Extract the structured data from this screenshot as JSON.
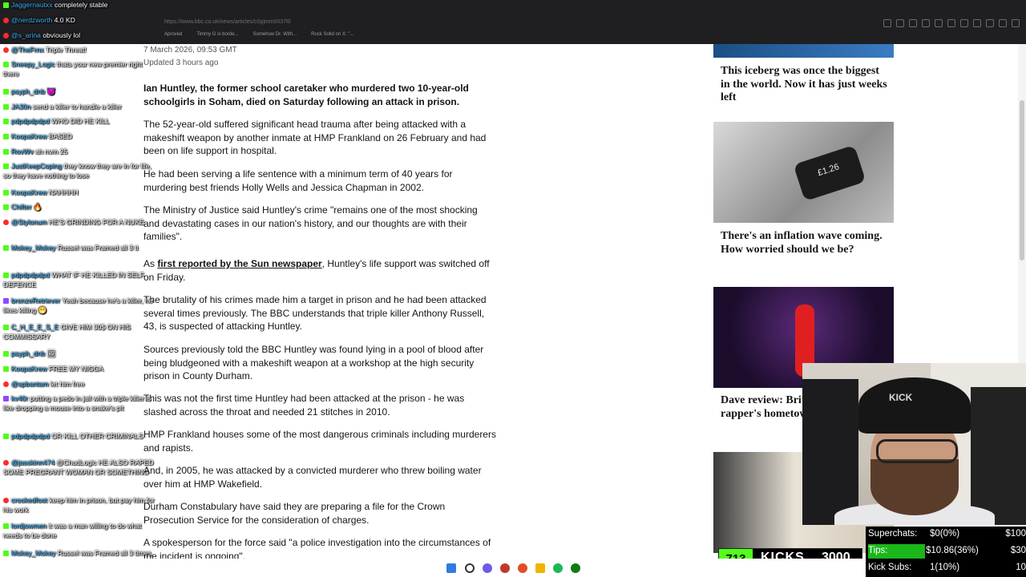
{
  "browser": {
    "url": "https://www.bbc.co.uk/news/articles/c0pjmm0037l0",
    "bookmarks": [
      "Aproved",
      "Timmy G is borde...",
      "Somehow Dr. With...",
      "Rock Solid on X: \"..."
    ]
  },
  "article": {
    "date": "7 March 2026, 09:53 GMT",
    "updated": "Updated 3 hours ago",
    "intro": "Ian Huntley, the former school caretaker who murdered two 10-year-old schoolgirls in Soham, died on Saturday following an attack in prison.",
    "p1": "The 52-year-old suffered significant head trauma after being attacked with a makeshift weapon by another inmate at HMP Frankland on 26 February and had been on life support in hospital.",
    "p2": "He had been serving a life sentence with a minimum term of 40 years for murdering best friends Holly Wells and Jessica Chapman in 2002.",
    "p3": "The Ministry of Justice said Huntley's crime \"remains one of the most shocking and devastating cases in our nation's history, and our thoughts are with their families\".",
    "p4_prefix": "As ",
    "p4_link": "first reported by the Sun newspaper",
    "p4_suffix": ", Huntley's life support was switched off on Friday.",
    "p5": "The brutality of his crimes made him a target in prison and he had been attacked several times previously. The BBC understands that triple killer Anthony Russell, 43, is suspected of attacking Huntley.",
    "p6": "Sources previously told the BBC Huntley was found lying in a pool of blood after being bludgeoned with a makeshift weapon at a workshop at the high security prison in County Durham.",
    "p7": "This was not the first time Huntley had been attacked at the prison - he was slashed across the throat and needed 21 stitches in 2010.",
    "p8": "HMP Frankland houses some of the most dangerous criminals including murderers and rapists.",
    "p9": "And, in 2005, he was attacked by a convicted murderer who threw boiling water over him at HMP Wakefield.",
    "p10": "Durham Constabulary have said they are preparing a file for the Crown Prosecution Service for the consideration of charges.",
    "p11": "A spokesperson for the force said \"a police investigation into the circumstances of the incident is ongoing\"."
  },
  "sidebar": {
    "cards": [
      {
        "title": "This iceberg was once the biggest in the world. Now it has just weeks left"
      },
      {
        "title": "There's an inflation wave coming. How worried should we be?",
        "image_text": "£1.26"
      },
      {
        "title": "Dave review: Brit transcends rapper's hometown gig"
      },
      {
        "title": ""
      }
    ]
  },
  "chat": [
    {
      "badge": "k",
      "user": "Jaggernautxx",
      "text": "completely stable"
    },
    {
      "badge": "y",
      "user": "@nerdzworth",
      "text": "4.0 KD"
    },
    {
      "badge": "y",
      "user": "@s_arina",
      "text": "obviously lol"
    },
    {
      "badge": "y",
      "user": "@TheFrnx",
      "text": "Triple Threat!"
    },
    {
      "badge": "k",
      "user": "Sneepy_Logic",
      "text": "thats your new premier right there"
    },
    {
      "badge": "k",
      "user": "psyph_dnb",
      "text": "😈"
    },
    {
      "badge": "k",
      "user": "JA30n",
      "text": "send a killer to handle a killer"
    },
    {
      "badge": "k",
      "user": "pdpdpdpdpd",
      "text": "WHO DID HE KILL"
    },
    {
      "badge": "k",
      "user": "KoopaKrew",
      "text": "BASED"
    },
    {
      "badge": "k",
      "user": "RovWv",
      "text": "ah nvm 25"
    },
    {
      "badge": "k",
      "user": "JustKeepCoping",
      "text": "they know they are in for life, so they have nothing to lose"
    },
    {
      "badge": "k",
      "user": "KoopaKrew",
      "text": "NAHHHH"
    },
    {
      "badge": "k",
      "user": "Chifter",
      "text": "🔥"
    },
    {
      "badge": "y",
      "user": "@Stylonum",
      "text": "HE'S GRINDING FOR A NUKE"
    },
    {
      "badge": "k",
      "user": "Mokey_Mokey",
      "text": "Russel was Framed all 3 ti"
    },
    {
      "badge": "k",
      "user": "pdpdpdpdpd",
      "text": "WHAT IF HE KILLED IN SELF DEFENCE"
    },
    {
      "badge": "t",
      "user": "bronzeRetriever",
      "text": "Yeah because he's a killer, he likes killing 😁"
    },
    {
      "badge": "k",
      "user": "C_H_E_E_S_E",
      "text": "GIVE HIM 30$ ON HIS COMMISSARY"
    },
    {
      "badge": "k",
      "user": "psyph_dnb",
      "text": "🖼"
    },
    {
      "badge": "k",
      "user": "KoopaKrew",
      "text": "FREE MY NIGGA"
    },
    {
      "badge": "y",
      "user": "@spbantam",
      "text": "let him free"
    },
    {
      "badge": "t",
      "user": "kv40r",
      "text": "putting a pedo in jail with a triple killer is like dropping a mouse into a snake's pit"
    },
    {
      "badge": "k",
      "user": "pdpdpdpdpd",
      "text": "OR KILL OTHER CRIMINALS"
    },
    {
      "badge": "y",
      "user": "@jasskinn474",
      "text": "@ChudLogic HE ALSO RAPED SOME PREGRANT WOMAN OR SOMETHING"
    },
    {
      "badge": "y",
      "user": "crookedfoot",
      "text": "keep him in prison, but pay him for his work"
    },
    {
      "badge": "k",
      "user": "lordjowmen",
      "text": "it was a man willing to do what needs to be done"
    },
    {
      "badge": "k",
      "user": "Mokey_Mokey",
      "text": "Russel was Framed all 3 times"
    }
  ],
  "stream": {
    "cam_cap_text": "KICK",
    "kicks_count": "713",
    "kicks_label": "KICKS",
    "kicks_goal": "3000",
    "superchats_label": "Superchats:",
    "superchats_value": "$0(0%)",
    "superchats_goal": "$100",
    "tips_label": "Tips:",
    "tips_value": "$10.86(36%)",
    "tips_progress": 0.36,
    "tips_goal": "$30",
    "kick_subs_label": "Kick Subs:",
    "kick_subs_value": "1(10%)",
    "kick_subs_goal": "10"
  },
  "colors": {
    "kick_green": "#53fc18",
    "chat_username": "#3db6ff",
    "youtube_red": "#ff2b2b",
    "twitch_purple": "#9147ff"
  }
}
